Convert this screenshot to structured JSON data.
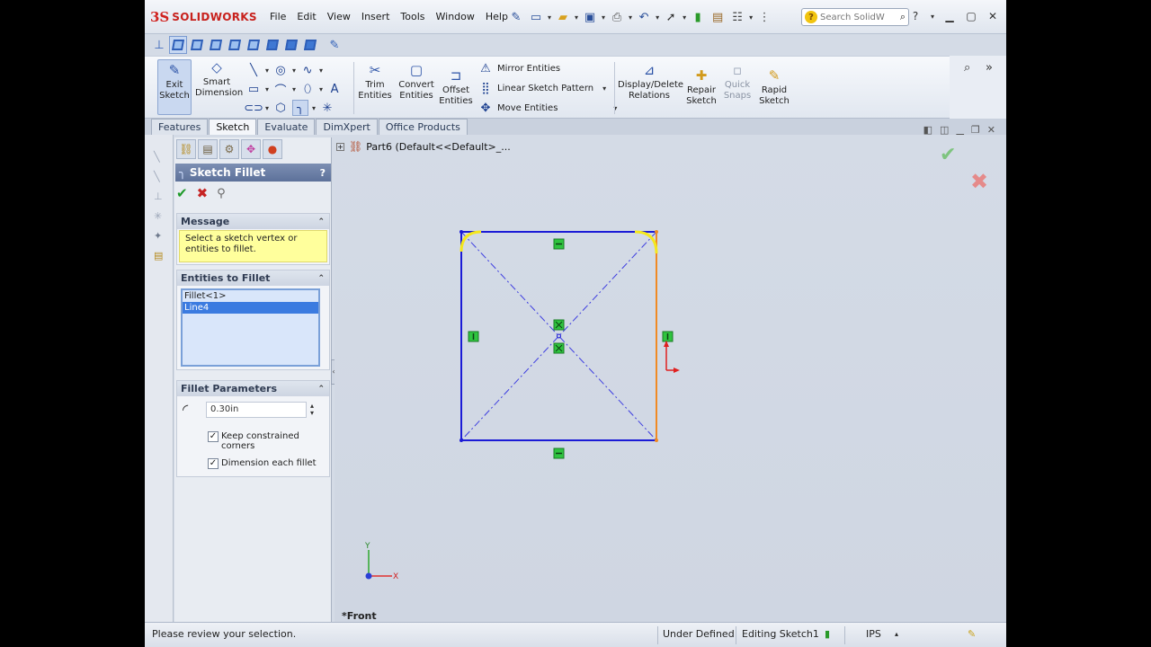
{
  "app": {
    "logo_ds": "3S",
    "logo_name": "SOLIDWORKS",
    "menu": [
      "File",
      "Edit",
      "View",
      "Insert",
      "Tools",
      "Window",
      "Help"
    ],
    "search_placeholder": "Search SolidW"
  },
  "commands": {
    "exit_sketch": "Exit Sketch",
    "smart_dimension": "Smart Dimension",
    "trim_entities": "Trim Entities",
    "convert_entities": "Convert Entities",
    "offset_entities": "Offset Entities",
    "mirror_entities": "Mirror Entities",
    "linear_pattern": "Linear Sketch Pattern",
    "move_entities": "Move Entities",
    "display_relations": "Display/Delete Relations",
    "repair_sketch": "Repair Sketch",
    "quick_snaps": "Quick Snaps",
    "rapid_sketch": "Rapid Sketch"
  },
  "tabs": [
    "Features",
    "Sketch",
    "Evaluate",
    "DimXpert",
    "Office Products"
  ],
  "active_tab": "Sketch",
  "property_manager": {
    "title": "Sketch Fillet",
    "help": "?",
    "message": {
      "header": "Message",
      "text": "Select a sketch vertex or entities to fillet."
    },
    "entities": {
      "header": "Entities to Fillet",
      "items": [
        "Fillet<1>",
        "Line4"
      ],
      "selected_index": 1
    },
    "parameters": {
      "header": "Fillet Parameters",
      "radius": "0.30in",
      "keep_constrained": {
        "label": "Keep constrained corners",
        "checked": true
      },
      "dimension_each": {
        "label": "Dimension each fillet",
        "checked": true
      }
    }
  },
  "graphics": {
    "tree_label": "Part6  (Default<<Default>_...",
    "view_label": "*Front",
    "axis_y": "Y",
    "axis_x": "X"
  },
  "status": {
    "message": "Please review your selection.",
    "definition": "Under Defined",
    "editing": "Editing Sketch1",
    "units": "IPS"
  },
  "colors": {
    "sketch_line": "#1b1bd6",
    "selected_line": "#f08a24",
    "fillet_preview": "#f4e71e",
    "relation_icon": "#2fc43f"
  }
}
